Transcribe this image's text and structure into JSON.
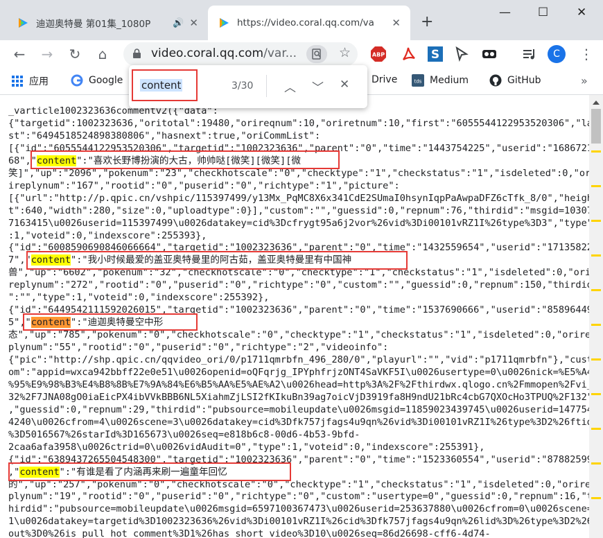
{
  "tabs": [
    {
      "title": "迪迦奥特曼 第01集_1080P",
      "audio_icon": "speaker-icon",
      "close": "✕"
    },
    {
      "title": "https://video.coral.qq.com/va",
      "close": "✕"
    }
  ],
  "window_controls": {
    "minimize": "—",
    "maximize": "☐",
    "close": "✕"
  },
  "new_tab": "+",
  "toolbar": {
    "back": "←",
    "forward": "→",
    "reload": "↻",
    "home": "⌂",
    "url_host": "video.coral.qq.com",
    "url_rest": "/var...",
    "star": "☆",
    "menu": "⋮",
    "profile_initial": "C"
  },
  "extensions": [
    "ABP",
    "pdf",
    "S",
    "pointer",
    "glasses",
    "playlist"
  ],
  "bookmarks": [
    {
      "label": "应用",
      "icon": "apps-grid-icon"
    },
    {
      "label": "Google",
      "icon": "google-icon"
    },
    {
      "label": "Drive",
      "icon": "drive-icon"
    },
    {
      "label": "Medium",
      "icon": "tds-icon"
    },
    {
      "label": "GitHub",
      "icon": "github-icon"
    }
  ],
  "bookmarks_overflow": "»",
  "find": {
    "query": "content",
    "count": "3/30",
    "prev": "︿",
    "next": "﹀",
    "close": "✕"
  },
  "json_lines": [
    [
      "_varticle1002323636commentv2({\"data\":"
    ],
    [
      "{\"targetid\":1002323636,\"oritotal\":19480,\"orireqnum\":10,\"oriretnum\":10,\"first\":\"6055544122953520306\",\"la"
    ],
    [
      "st\":\"6494518524898380806\",\"hasnext\":true,\"oriCommList\":"
    ],
    [
      "[{\"id\":\"6055544122953520306\",\"targetid\":\"1002323636\",\"parent\":\"0\",\"time\":\"1443754225\",\"userid\":\"1686721"
    ],
    [
      "68\",\"",
      "content",
      "\":\"喜欢长野博扮演的大古，帅帅哒[微笑][微笑][微"
    ],
    [
      "笑]\",\"up\":\"2096\",\"pokenum\":\"23\",\"checkhotscale\":\"0\",\"checktype\":\"1\",\"checkstatus\":\"1\",\"isdeleted\":0,\"or"
    ],
    [
      "ireplynum\":\"167\",\"rootid\":\"0\",\"puserid\":\"0\",\"richtype\":\"1\",\"picture\":"
    ],
    [
      "[{\"url\":\"http://p.qpic.cn/vshpic/115397499/y13Mx_PqMC8X6x341CdE2SUmaI0hsynIqpPaAwpaDFZ6cTfk_8/0\",\"heigh"
    ],
    [
      "t\":640,\"width\":280,\"size\":0,\"uploadtype\":0}],\"custom\":\"\",\"guessid\":0,\"repnum\":76,\"thirdid\":\"msgid=10307"
    ],
    [
      "7163415\\u0026userid=115397499\\u0026datakey=cid%3Dcfrygt95a6j2vor%26vid%3Di00101vRZ1I%26type%3D3\",\"type\""
    ],
    [
      ":1,\"voteid\":0,\"indexscore\":255393},"
    ],
    [
      "{\"id\":\"6008590690846066664\",\"targetid\":\"1002323636\",\"parent\":\"0\",\"time\":\"1432559654\",\"userid\":\"17135822"
    ],
    [
      "7\",\"",
      "content",
      "\":\"我小时候最爱的盖亚奥特曼里的阿古茹，盖亚奥特曼里有中国神"
    ],
    [
      "兽\",\"up\":\"6602\",\"pokenum\":\"32\",\"checkhotscale\":\"0\",\"checktype\":\"1\",\"checkstatus\":\"1\",\"isdeleted\":0,\"ori"
    ],
    [
      "replynum\":\"272\",\"rootid\":\"0\",\"puserid\":\"0\",\"richtype\":\"0\",\"custom\":\"\",\"guessid\":0,\"repnum\":150,\"thirdid"
    ],
    [
      "\":\"\",\"type\":1,\"voteid\":0,\"indexscore\":255392},"
    ],
    [
      "{\"id\":\"6449542111592026015\",\"targetid\":\"1002323636\",\"parent\":\"0\",\"time\":\"1537690666\",\"userid\":\"85896449"
    ],
    [
      "5\",\"",
      "content",
      "\":\"迪迦奥特曼空中形"
    ],
    [
      "态\",\"up\":\"785\",\"pokenum\":\"0\",\"checkhotscale\":\"0\",\"checktype\":\"1\",\"checkstatus\":\"1\",\"isdeleted\":0,\"orire"
    ],
    [
      "plynum\":\"55\",\"rootid\":\"0\",\"puserid\":\"0\",\"richtype\":\"2\",\"videoinfo\":"
    ],
    [
      "{\"pic\":\"http://shp.qpic.cn/qqvideo_ori/0/p1711qmrbfn_496_280/0\",\"playurl\":\"\",\"vid\":\"p1711qmrbfn\"},\"cust"
    ],
    [
      "om\":\"appid=wxca942bbff22e0e51\\u0026openid=oQFqrjg_IPYphfrjzONT4SaVKF5I\\u0026usertype=0\\u0026nick=%E5%A4"
    ],
    [
      "%95%E9%98%B3%E4%B8%8B%E7%9A%84%E6%B5%AA%E5%AE%A2\\u0026head=http%3A%2F%2Fthirdwx.qlogo.cn%2Fmmopen%2Fvi_"
    ],
    [
      "32%2F7JNA08gO0iaEicPX4ibVVkBBB6NL5XiahmZjLSI2fKIkuBn39ag7oicVjD3919fa8H9ndU21bRc4cbG7QXOcHo3TPUQ%2F132\""
    ],
    [
      ",\"guessid\":0,\"repnum\":29,\"thirdid\":\"pubsource=mobileupdate\\u0026msgid=11859023439745\\u0026userid=147754"
    ],
    [
      "4240\\u0026cfrom=4\\u0026scene=3\\u0026datakey=cid%3Dfk757jfags4u9qn%26vid%3Di00101vRZ1I%26type%3D2%26ftid"
    ],
    [
      "%3D5016567%26starId%3D165673\\u0026seq=e818b6c8-00d6-4b53-9bfd-"
    ],
    [
      "2caa6afa3958\\u0026ctrid=0\\u0026vidAudit=0\",\"type\":1,\"voteid\":0,\"indexscore\":255391},"
    ],
    [
      "{\"id\":\"6389437265504548300\",\"targetid\":\"1002323636\",\"parent\":\"0\",\"time\":\"1523360554\",\"userid\":\"87882599"
    ],
    [
      ",\"",
      "content",
      "\":\"有谁是看了内涵再来刷一遍童年回忆"
    ],
    [
      "的\",\"up\":\"257\",\"pokenum\":\"0\",\"checkhotscale\":\"0\",\"checktype\":\"1\",\"checkstatus\":\"1\",\"isdeleted\":0,\"orire"
    ],
    [
      "plynum\":\"19\",\"rootid\":\"0\",\"puserid\":\"0\",\"richtype\":\"0\",\"custom\":\"usertype=0\",\"guessid\":0,\"repnum\":16,\"t"
    ],
    [
      "hirdid\":\"pubsource=mobileupdate\\u0026msgid=6597100367473\\u0026userid=253637880\\u0026cfrom=0\\u0026scene="
    ],
    [
      "1\\u0026datakey=targetid%3D1002323636%26vid%3Di00101vRZ1I%26cid%3Dfk757jfags4u9qn%26lid%3D%26type%3D2%26"
    ],
    [
      "out%3D0%26is_pull_hot_comment%3D1%26has_short_video%3D10\\u0026seq=86d26698-cff6-4d74-"
    ]
  ],
  "current_match_line": 17
}
